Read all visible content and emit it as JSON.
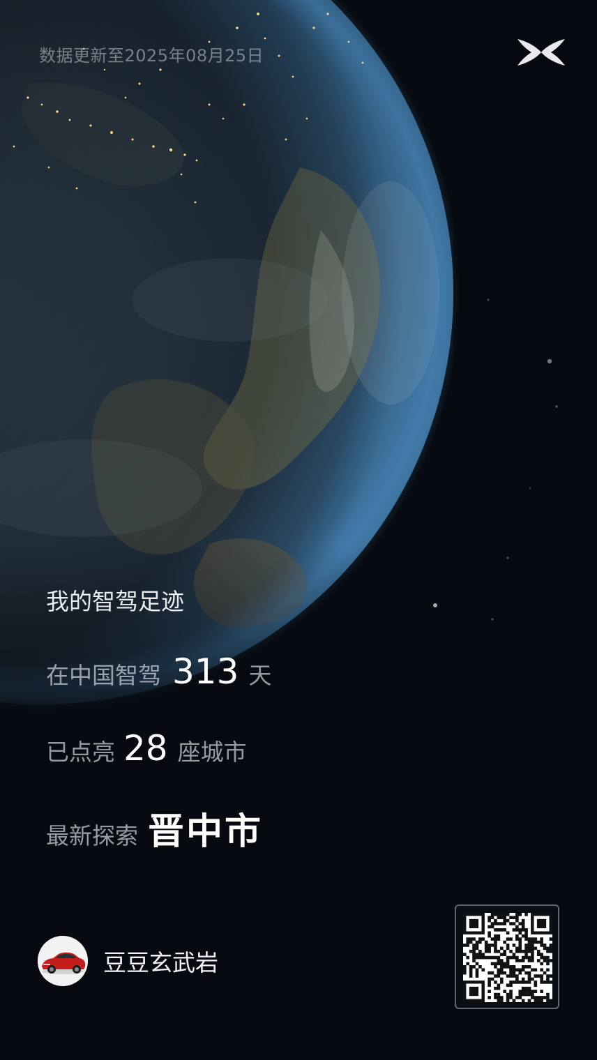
{
  "header": {
    "update_text": "数据更新至2025年08月25日",
    "logo_icon": "xpeng-x-logo-icon"
  },
  "footprint": {
    "title": "我的智驾足迹",
    "days_label": "在中国智驾",
    "days_value": "313",
    "days_unit": "天",
    "cities_label": "已点亮",
    "cities_value": "28",
    "cities_unit": "座城市",
    "latest_label": "最新探索",
    "latest_value": "晋中市"
  },
  "profile": {
    "avatar_icon": "red-car-avatar-icon",
    "username": "豆豆玄武岩"
  },
  "qr": {
    "icon": "qr-code-icon"
  },
  "colors": {
    "background": "#070b11",
    "text_primary": "#ffffff",
    "text_secondary": "#c8ccd6",
    "earth_glow": "#3a6f9a"
  }
}
